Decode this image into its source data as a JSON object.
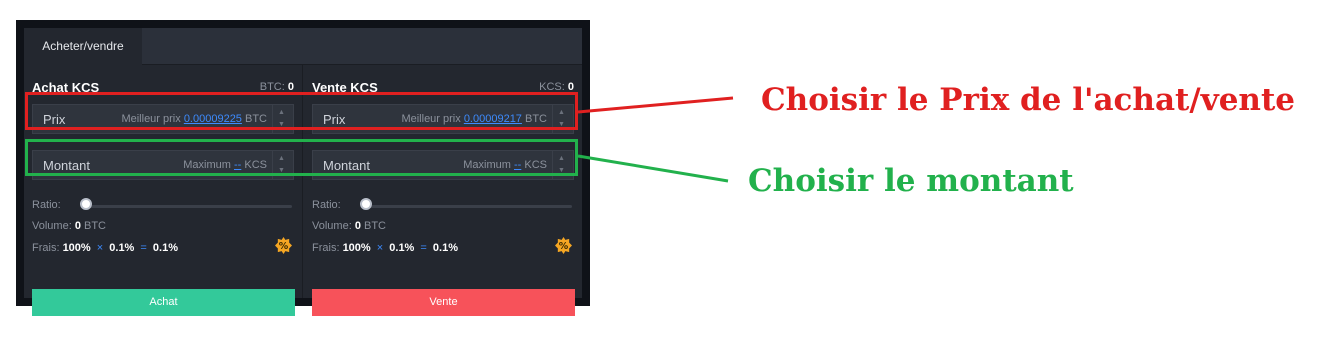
{
  "tab": {
    "label": "Acheter/vendre"
  },
  "buy": {
    "title": "Achat KCS",
    "balance_label": "BTC:",
    "balance_value": "0",
    "price": {
      "label": "Prix",
      "hint": "Meilleur prix",
      "best": "0.00009225",
      "unit": "BTC"
    },
    "amount": {
      "label": "Montant",
      "hint": "Maximum",
      "max": "--",
      "unit": "KCS"
    },
    "ratio_label": "Ratio:",
    "ratio_value": 0,
    "volume": {
      "label": "Volume:",
      "value": "0",
      "unit": "BTC"
    },
    "fees": {
      "label": "Frais:",
      "base": "100%",
      "times": "×",
      "rate": "0.1%",
      "equals": "=",
      "result": "0.1%"
    },
    "button_label": "Achat"
  },
  "sell": {
    "title": "Vente KCS",
    "balance_label": "KCS:",
    "balance_value": "0",
    "price": {
      "label": "Prix",
      "hint": "Meilleur prix",
      "best": "0.00009217",
      "unit": "BTC"
    },
    "amount": {
      "label": "Montant",
      "hint": "Maximum",
      "max": "--",
      "unit": "KCS"
    },
    "ratio_label": "Ratio:",
    "ratio_value": 0,
    "volume": {
      "label": "Volume:",
      "value": "0",
      "unit": "BTC"
    },
    "fees": {
      "label": "Frais:",
      "base": "100%",
      "times": "×",
      "rate": "0.1%",
      "equals": "=",
      "result": "0.1%"
    },
    "button_label": "Vente"
  },
  "annotations": {
    "price_note": "Choisir le Prix de l'achat/vente",
    "amount_note": "Choisir le montant"
  },
  "colors": {
    "buy": "#33c99a",
    "sell": "#f7525a",
    "link": "#3d8bfd",
    "price_highlight": "#e02020",
    "amount_highlight": "#22b14c",
    "fee_badge": "#f5a623"
  },
  "icons": {
    "fee_badge": "percent-badge-icon",
    "spin": "stepper-arrows-icon"
  }
}
